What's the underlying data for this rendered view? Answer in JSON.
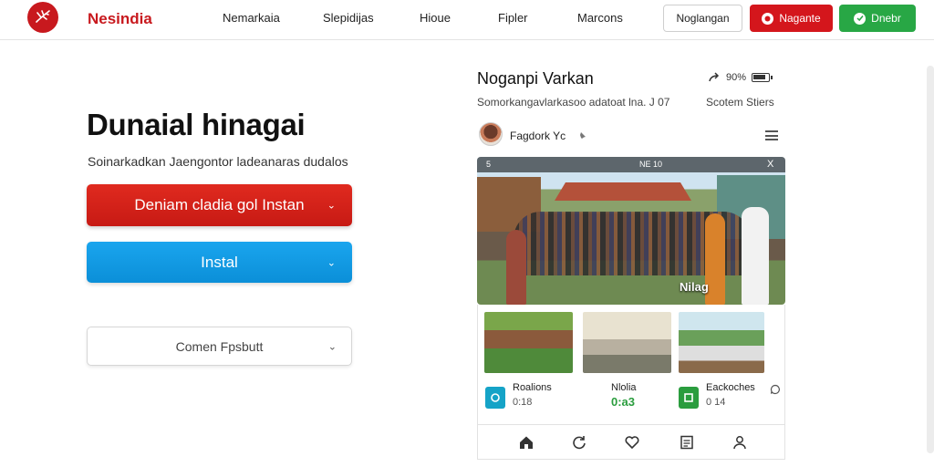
{
  "brand": {
    "name": "Nesindia",
    "accent": "#c8191e"
  },
  "nav": {
    "links": [
      "Nemarkaia",
      "Slepidijas",
      "Hioue",
      "Fipler",
      "Marcons"
    ],
    "outline_button": "Noglangan",
    "red_button": "Nagante",
    "green_button": "Dnebr"
  },
  "hero": {
    "title": "Dunaial hinagai",
    "subtitle": "Soinarkadkan Jaengontor ladeanaras dudalos",
    "cta_primary": "Deniam cladia gol Instan",
    "cta_secondary": "Instal",
    "cta_tertiary": "Comen Fpsbutt"
  },
  "panel": {
    "title": "Noganpi Varkan",
    "status_text": "90%",
    "description": "Somorkangavlarkasoo adatoat lna. J 07",
    "description_right": "Scotem Stiers",
    "post_author": "Fagdork Yc",
    "photo_caption": "Nilag",
    "photo_status": [
      "5",
      "NE 10",
      "X"
    ],
    "stats": [
      {
        "label": "Roalions",
        "value": "0:18",
        "color": "#15a3c7",
        "value_color": "#555555"
      },
      {
        "label": "Nlolia",
        "value": "0:a3",
        "color": "#ffffff",
        "value_color": "#2a9d3e"
      },
      {
        "label": "Eackoches",
        "value": "0 14",
        "color": "#2a9d3e",
        "value_color": "#555555"
      }
    ],
    "bottom_nav_icons": [
      "home-icon",
      "refresh-icon",
      "heart-icon",
      "document-icon",
      "profile-icon"
    ]
  },
  "colors": {
    "primary_red": "#d4161c",
    "primary_blue": "#0b8fd8",
    "green": "#28a745"
  }
}
